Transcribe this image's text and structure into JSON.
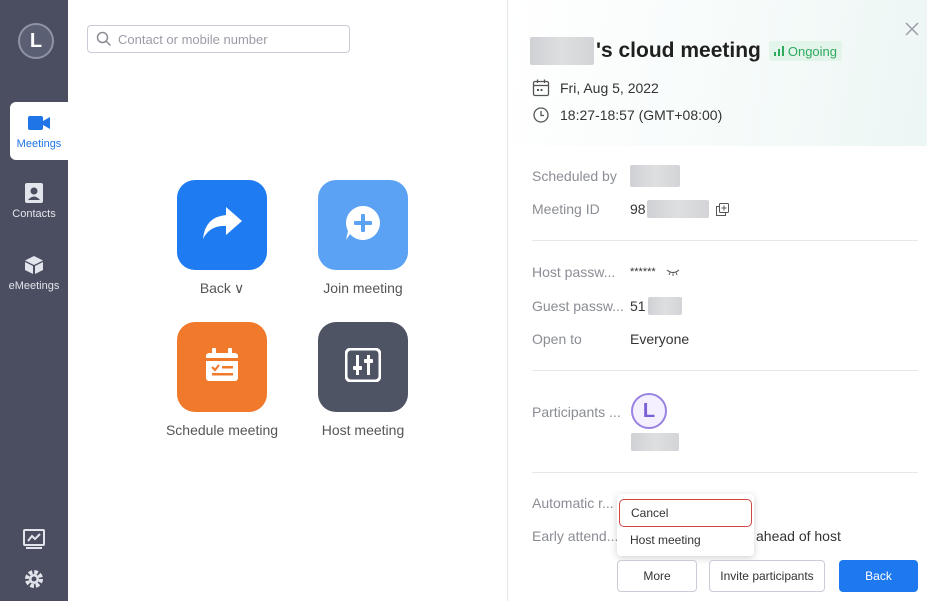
{
  "sidebar": {
    "avatar_letter": "L",
    "items": [
      {
        "label": "Meetings",
        "icon": "video-camera-icon",
        "active": true
      },
      {
        "label": "Contacts",
        "icon": "contact-card-icon",
        "active": false
      },
      {
        "label": "eMeetings",
        "icon": "cube-icon",
        "active": false
      }
    ],
    "bottom_icons": [
      "whiteboard-icon",
      "gear-icon"
    ]
  },
  "search": {
    "placeholder": "Contact or mobile number"
  },
  "actions": [
    {
      "label": "Back",
      "suffix": "∨",
      "icon": "share-arrow-icon",
      "color": "#1e7bf2"
    },
    {
      "label": "Join meeting",
      "icon": "plus-bubble-icon",
      "color": "#5ba2f4"
    },
    {
      "label": "Schedule meeting",
      "icon": "calendar-icon",
      "color": "#f0792c"
    },
    {
      "label": "Host meeting",
      "icon": "sliders-icon",
      "color": "#4e5464"
    }
  ],
  "meeting": {
    "title_suffix": "'s cloud meeting",
    "status": "Ongoing",
    "date": "Fri, Aug 5, 2022",
    "time": "18:27-18:57 (GMT+08:00)",
    "fields": {
      "scheduled_by": {
        "label": "Scheduled by"
      },
      "meeting_id": {
        "label": "Meeting ID",
        "value_prefix": "98"
      },
      "host_password": {
        "label": "Host passw...",
        "value": "******"
      },
      "guest_password": {
        "label": "Guest passw...",
        "value_prefix": "51"
      },
      "open_to": {
        "label": "Open to",
        "value": "Everyone"
      },
      "participants": {
        "label": "Participants ...",
        "avatar_letter": "L"
      },
      "automatic": {
        "label": "Automatic r..."
      },
      "early_attend": {
        "label": "Early attend...",
        "value": "ahead of host"
      }
    }
  },
  "dropdown": {
    "items": [
      "Cancel",
      "Host meeting"
    ]
  },
  "buttons": {
    "more": "More",
    "invite": "Invite participants",
    "back": "Back"
  },
  "colors": {
    "primary": "#1e78f0",
    "sidebar": "#4a4e60",
    "ongoing": "#2eaa5e"
  }
}
